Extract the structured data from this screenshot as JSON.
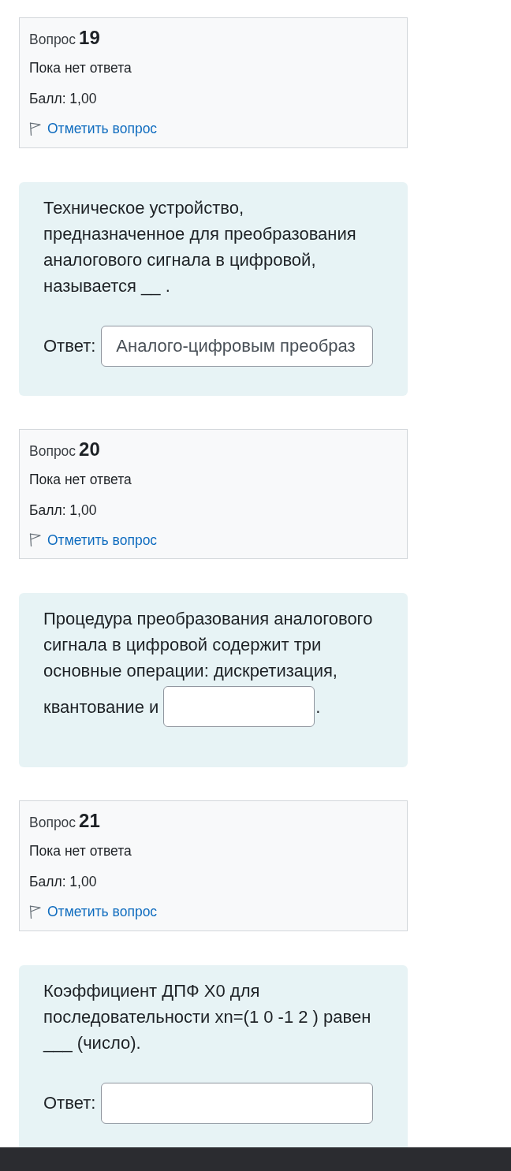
{
  "questions": [
    {
      "label": "Вопрос",
      "number": "19",
      "status": "Пока нет ответа",
      "grade": "Балл: 1,00",
      "flag_link": "Отметить вопрос",
      "kind": "short_answer",
      "text": "Техническое устройство, предназначенное для преобразования аналогового сигнала в цифровой, называется __ .",
      "answer_label": "Ответ:",
      "answer_value": "Аналого-цифровым преобраз"
    },
    {
      "label": "Вопрос",
      "number": "20",
      "status": "Пока нет ответа",
      "grade": "Балл: 1,00",
      "flag_link": "Отметить вопрос",
      "kind": "inline_blank",
      "text": "Процедура преобразования аналогового сигнала в цифровой содержит три основные операции: дискретизация,",
      "text_before_blank": "квантование и",
      "text_after": "."
    },
    {
      "label": "Вопрос",
      "number": "21",
      "status": "Пока нет ответа",
      "grade": "Балл: 1,00",
      "flag_link": "Отметить вопрос",
      "kind": "short_answer",
      "text": "Коэффициент ДПФ X0 для последовательности xn=(1 0 -1 2 ) равен ___ (число).",
      "answer_label": "Ответ:"
    }
  ]
}
